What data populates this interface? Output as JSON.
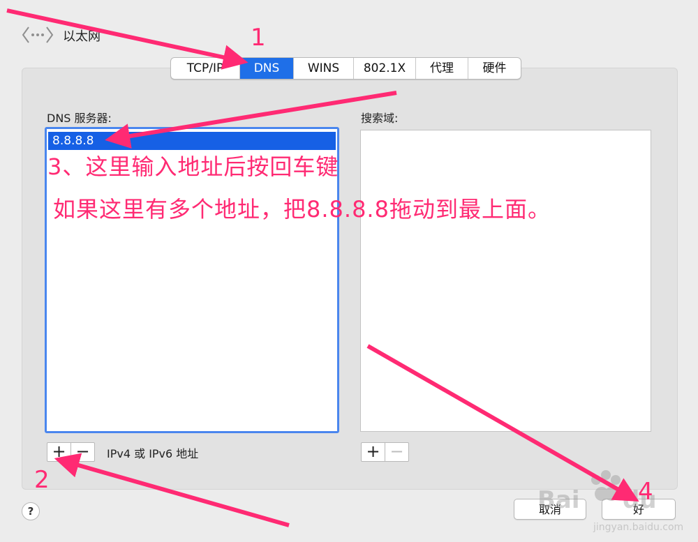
{
  "window": {
    "title": "以太网"
  },
  "tabs": [
    {
      "label": "TCP/IP",
      "active": false
    },
    {
      "label": "DNS",
      "active": true
    },
    {
      "label": "WINS",
      "active": false
    },
    {
      "label": "802.1X",
      "active": false
    },
    {
      "label": "代理",
      "active": false
    },
    {
      "label": "硬件",
      "active": false
    }
  ],
  "dns": {
    "label": "DNS 服务器:",
    "entries": [
      "8.8.8.8"
    ],
    "hint": "IPv4 或 IPv6 地址",
    "add": "+",
    "remove": "−"
  },
  "search_domains": {
    "label": "搜索域:",
    "add": "+",
    "remove": "−"
  },
  "footer": {
    "help": "?",
    "cancel": "取消",
    "ok": "好"
  },
  "annotations": {
    "step1": "1",
    "step2": "2",
    "step3_text": "3、这里输入地址后按回车键",
    "step3_note": "如果这里有多个地址，把8.8.8.8拖动到最上面。",
    "step4": "4"
  },
  "watermark": {
    "brand": "Bai du 经验",
    "url": "jingyan.baidu.com"
  },
  "colors": {
    "accent": "#1f6fe8",
    "selection": "#1660e5",
    "annotation": "#ff2a73"
  }
}
